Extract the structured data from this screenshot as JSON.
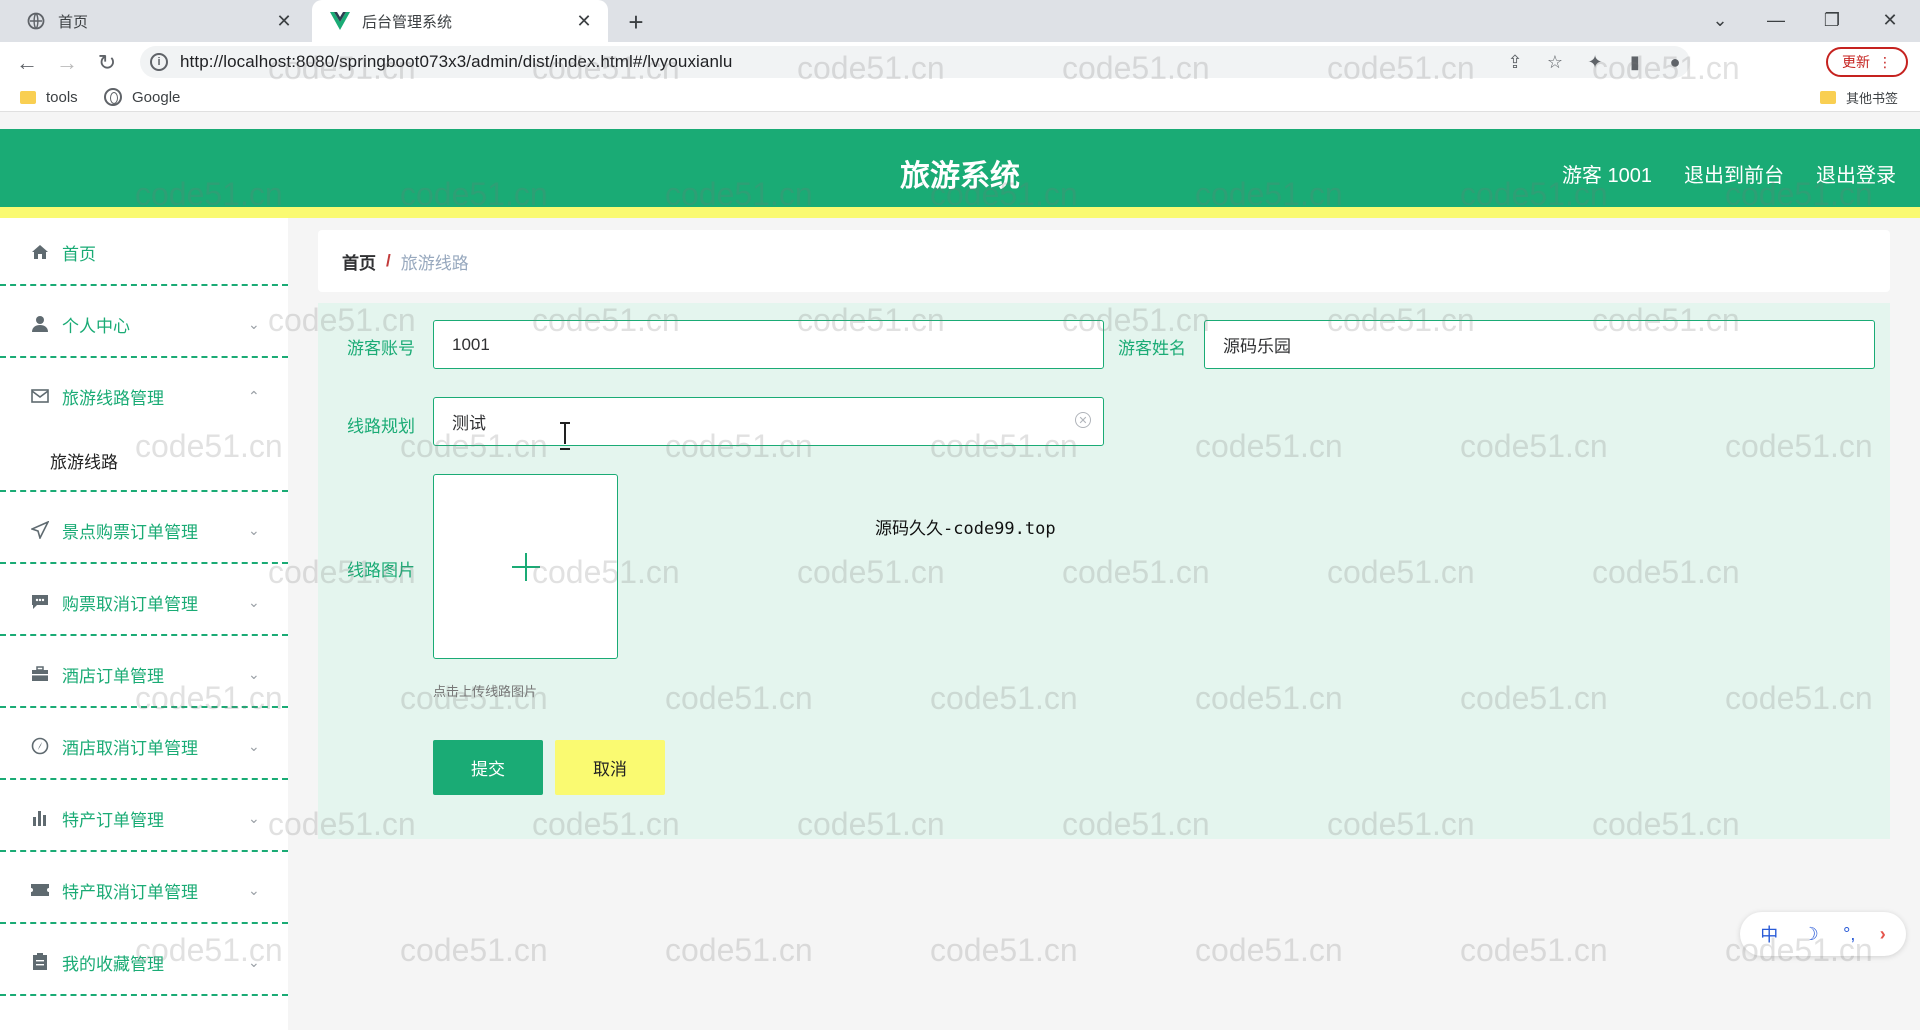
{
  "browser": {
    "tabs": [
      {
        "title": "首页",
        "active": false
      },
      {
        "title": "后台管理系统",
        "active": true
      }
    ],
    "url": "http://localhost:8080/springboot073x3/admin/dist/index.html#/lvyouxianlu",
    "update_label": "更新",
    "bookmarks": [
      {
        "label": "tools",
        "icon": "folder-icon"
      },
      {
        "label": "Google",
        "icon": "globe-icon"
      }
    ],
    "other_bookmarks": "其他书签"
  },
  "header": {
    "title": "旅游系统",
    "user": "游客 1001",
    "to_frontend": "退出到前台",
    "logout": "退出登录",
    "colors": {
      "primary": "#1aab75",
      "accent": "#fafa71"
    }
  },
  "sidebar": {
    "items": [
      {
        "label": "首页",
        "icon": "home-icon",
        "has_chevron": false
      },
      {
        "label": "个人中心",
        "icon": "user-icon",
        "has_chevron": true
      },
      {
        "label": "旅游线路管理",
        "icon": "envelope-icon",
        "has_chevron": true,
        "expanded": true
      },
      {
        "label": "景点购票订单管理",
        "icon": "send-icon",
        "has_chevron": true
      },
      {
        "label": "购票取消订单管理",
        "icon": "chat-icon",
        "has_chevron": true
      },
      {
        "label": "酒店订单管理",
        "icon": "briefcase-icon",
        "has_chevron": true
      },
      {
        "label": "酒店取消订单管理",
        "icon": "compass-icon",
        "has_chevron": true
      },
      {
        "label": "特产订单管理",
        "icon": "bar-chart-icon",
        "has_chevron": true
      },
      {
        "label": "特产取消订单管理",
        "icon": "ticket-icon",
        "has_chevron": true
      },
      {
        "label": "我的收藏管理",
        "icon": "clipboard-icon",
        "has_chevron": true
      }
    ],
    "sub_item": "旅游线路"
  },
  "breadcrumb": {
    "home": "首页",
    "separator": "/",
    "current": "旅游线路"
  },
  "form": {
    "account_label": "游客账号",
    "account_value": "1001",
    "name_label": "游客姓名",
    "name_value": "源码乐园",
    "route_label": "线路规划",
    "route_value": "测试",
    "image_label": "线路图片",
    "upload_hint": "点击上传线路图片",
    "submit_label": "提交",
    "cancel_label": "取消"
  },
  "overlay_text": "源码久久-code99.top",
  "watermark": "code51.cn",
  "ime": {
    "lang": "中",
    "moon": "☽",
    "punct": "°,",
    "arrow": "›"
  }
}
